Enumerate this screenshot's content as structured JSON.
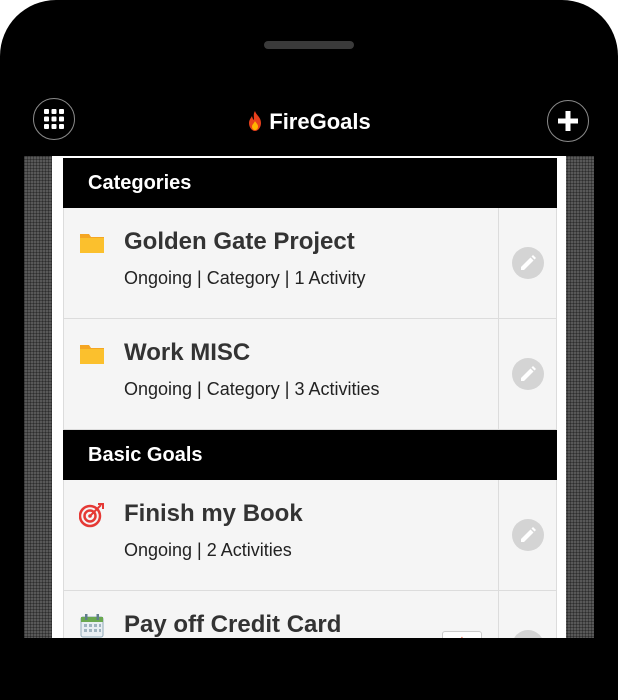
{
  "app": {
    "title": "FireGoals",
    "accent_color": "#e8401c"
  },
  "header": {
    "menu_icon": "grid-menu-icon",
    "add_icon": "plus-icon"
  },
  "sections": [
    {
      "title": "Categories",
      "items": [
        {
          "name": "Golden Gate Project",
          "meta": "Ongoing | Category | 1 Activity",
          "icon": "folder-icon"
        },
        {
          "name": "Work MISC",
          "meta": "Ongoing | Category | 3 Activities",
          "icon": "folder-icon"
        }
      ]
    },
    {
      "title": "Basic Goals",
      "items": [
        {
          "name": "Finish my Book",
          "meta": "Ongoing | 2 Activities",
          "icon": "target-icon"
        },
        {
          "name": "Pay off Credit Card",
          "meta": "",
          "icon": "calendar-icon"
        }
      ]
    }
  ]
}
